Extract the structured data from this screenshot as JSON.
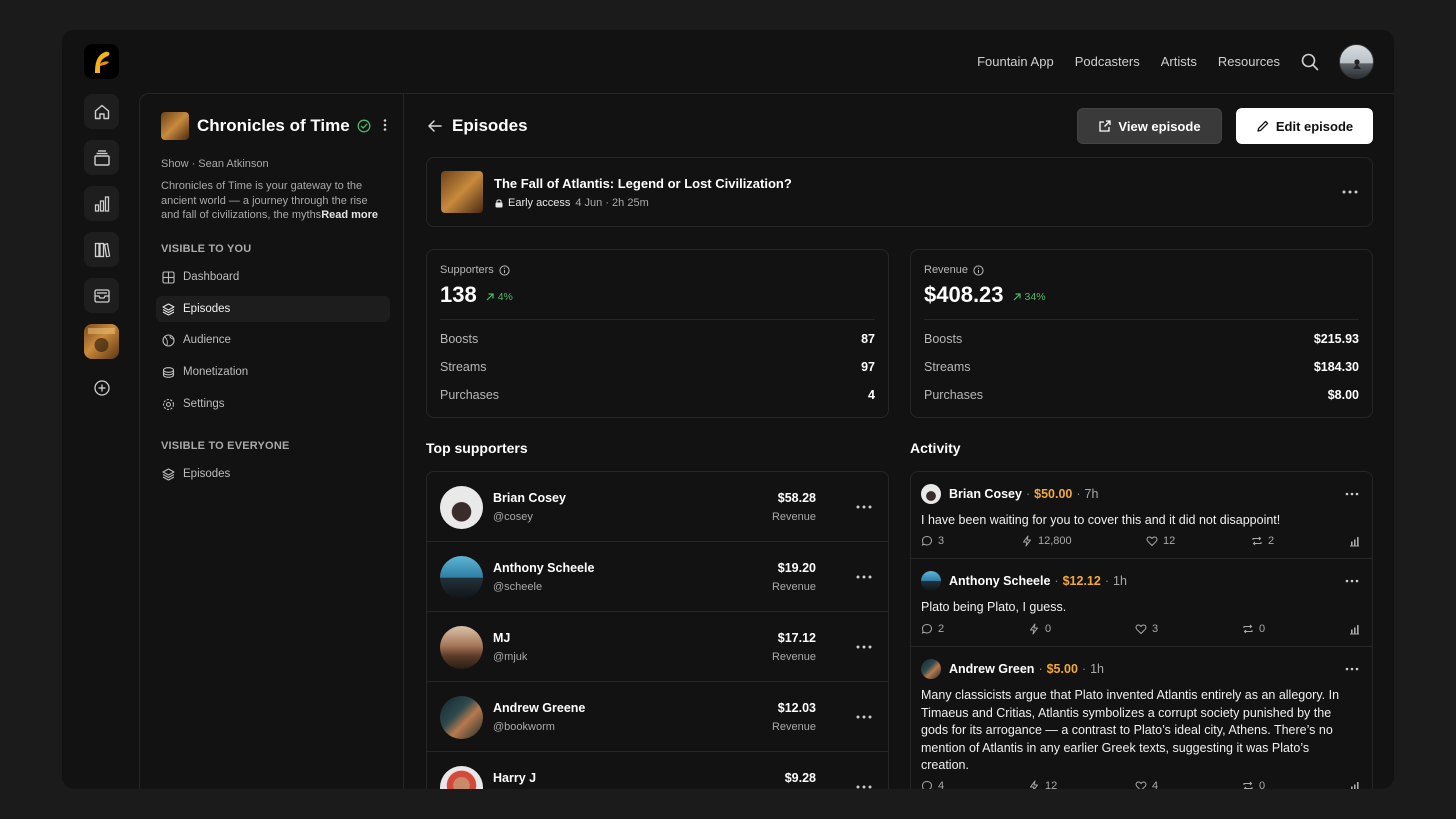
{
  "topnav": {
    "links": [
      "Fountain App",
      "Podcasters",
      "Artists",
      "Resources"
    ]
  },
  "rail": {
    "icons": [
      "home-icon",
      "stack-icon",
      "bar-chart-icon",
      "library-icon",
      "inbox-icon",
      "show-thumbnail",
      "add-circle-icon"
    ]
  },
  "sidebar": {
    "show_title": "Chronicles of Time",
    "meta": "Show · Sean Atkinson",
    "description": "Chronicles of Time is your gateway to the ancient world — a journey through the rise and fall of civilizations, the myths",
    "read_more": "Read more",
    "section_private": "VISIBLE TO YOU",
    "private_items": [
      {
        "label": "Dashboard",
        "icon": "grid-icon"
      },
      {
        "label": "Episodes",
        "icon": "layers-icon"
      },
      {
        "label": "Audience",
        "icon": "globe-icon"
      },
      {
        "label": "Monetization",
        "icon": "coins-icon"
      },
      {
        "label": "Settings",
        "icon": "gear-icon"
      }
    ],
    "section_public": "VISIBLE TO EVERYONE",
    "public_items": [
      {
        "label": "Episodes",
        "icon": "layers-icon"
      }
    ]
  },
  "header": {
    "title": "Episodes",
    "view_label": "View episode",
    "edit_label": "Edit episode"
  },
  "episode": {
    "title": "The Fall of Atlantis: Legend or Lost Civilization?",
    "access": "Early access",
    "meta": "4 Jun · 2h 25m"
  },
  "supporters": {
    "label": "Supporters",
    "value": "138",
    "delta": "4%",
    "rows": [
      {
        "label": "Boosts",
        "value": "87"
      },
      {
        "label": "Streams",
        "value": "97"
      },
      {
        "label": "Purchases",
        "value": "4"
      }
    ]
  },
  "revenue": {
    "label": "Revenue",
    "value": "$408.23",
    "delta": "34%",
    "rows": [
      {
        "label": "Boosts",
        "value": "$215.93"
      },
      {
        "label": "Streams",
        "value": "$184.30"
      },
      {
        "label": "Purchases",
        "value": "$8.00"
      }
    ]
  },
  "top_supporters": {
    "title": "Top supporters",
    "items": [
      {
        "name": "Brian Cosey",
        "handle": "@cosey",
        "amount": "$58.28",
        "label": "Revenue"
      },
      {
        "name": "Anthony Scheele",
        "handle": "@scheele",
        "amount": "$19.20",
        "label": "Revenue"
      },
      {
        "name": "MJ",
        "handle": "@mjuk",
        "amount": "$17.12",
        "label": "Revenue"
      },
      {
        "name": "Andrew Greene",
        "handle": "@bookworm",
        "amount": "$12.03",
        "label": "Revenue"
      },
      {
        "name": "Harry J",
        "handle": "",
        "amount": "$9.28",
        "label": ""
      }
    ]
  },
  "activity": {
    "title": "Activity",
    "items": [
      {
        "name": "Brian Cosey",
        "amount": "$50.00",
        "time": "7h",
        "text": "I have been waiting for you to cover this and it did not disappoint!",
        "comments": "3",
        "boosts": "12,800",
        "likes": "12",
        "reposts": "2"
      },
      {
        "name": "Anthony Scheele",
        "amount": "$12.12",
        "time": "1h",
        "text": "Plato being Plato, I guess.",
        "comments": "2",
        "boosts": "0",
        "likes": "3",
        "reposts": "0"
      },
      {
        "name": "Andrew Green",
        "amount": "$5.00",
        "time": "1h",
        "text": "Many classicists argue that Plato invented Atlantis entirely as an allegory. In Timaeus and Critias, Atlantis symbolizes a corrupt society punished by the gods for its arrogance — a contrast to Plato’s ideal city, Athens. There’s no mention of Atlantis in any earlier Greek texts, suggesting it was Plato’s creation.",
        "comments": "4",
        "boosts": "12",
        "likes": "4",
        "reposts": "0"
      }
    ]
  },
  "colors": {
    "accent_gold": "#f2a93b",
    "positive_green": "#4cb86a",
    "background": "#121212"
  }
}
